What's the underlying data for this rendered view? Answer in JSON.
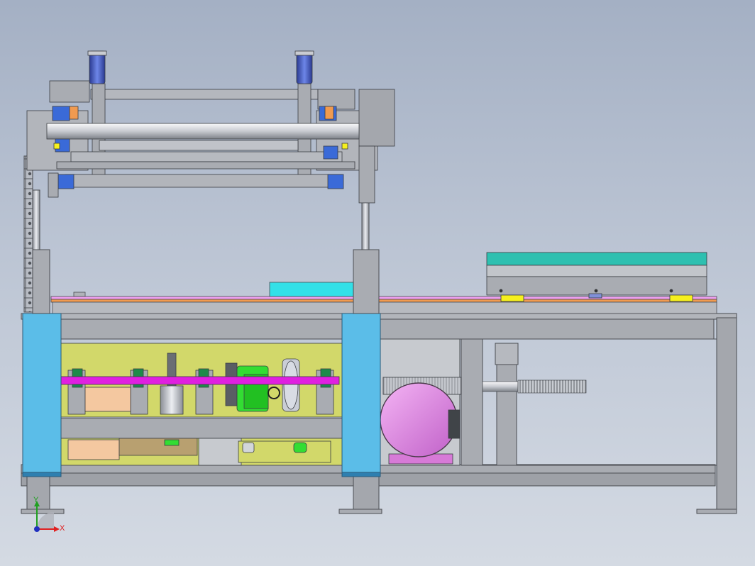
{
  "triad": {
    "x_label": "X",
    "y_label": "Y",
    "x_color": "#e02020",
    "y_color": "#20a020",
    "z_color": "#2030c0"
  },
  "colors": {
    "frame": "#a9acb2",
    "frame_edge": "#4a4d52",
    "guard": "#5bbde8",
    "motor": "#e88ae8",
    "shaft": "#e020e0",
    "bed_yellow": "#d2d86a",
    "green_part": "#33dd33",
    "cyan_block": "#33e0e8",
    "teal_plate": "#2ec0b0",
    "orange_strip": "#f09a50",
    "pink_strip": "#f0a0f0",
    "cylinder": "#4060c8",
    "yellow_pad": "#f6f01e",
    "peach_block": "#f4c8a0"
  }
}
